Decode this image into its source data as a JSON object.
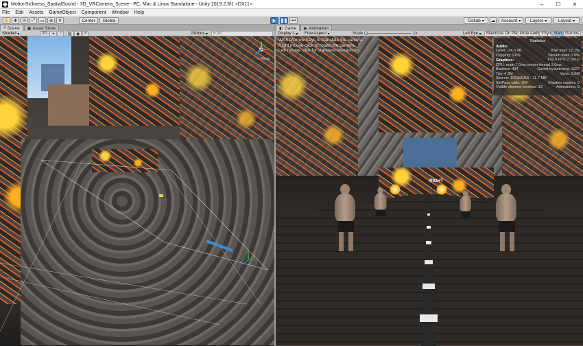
{
  "window": {
    "title": "MotionSickness_SpatialSound - 3D_VRCamera_Scene - PC, Mac & Linux Standalone - Unity 2019.2.3f1 <DX11>",
    "controls": {
      "minimize": "–",
      "maximize": "☐",
      "close": "✕"
    }
  },
  "menu": [
    "File",
    "Edit",
    "Assets",
    "GameObject",
    "Component",
    "Window",
    "Help"
  ],
  "toolbar": {
    "pivot_label": "Center",
    "space_label": "Global",
    "collab_label": "Collab",
    "account_label": "Account",
    "layers_label": "Layers",
    "layout_label": "Layout"
  },
  "scene_panel": {
    "tabs": [
      "Scene",
      "Asset Store"
    ],
    "shading_mode": "Shaded",
    "mode_2d": "2D",
    "gizmos_label": "Gizmos",
    "search_placeholder": "All",
    "persp_label": "< Persp"
  },
  "game_panel": {
    "tabs": [
      "Game",
      "Animation"
    ],
    "display": "Display 1",
    "aspect": "Free Aspect",
    "scale_label": "Scale",
    "scale_value": "1x",
    "eye": "Left Eye",
    "maximize_on_play": "Maximize On Play",
    "mute_audio": "Mute Audio",
    "vsync": "VSync",
    "stats": "Stats",
    "gizmos": "Gizmos",
    "instructions": [
      "WASD/Arrow Keys to translate the camera",
      "Right mouse click to rotate the camera",
      "Left mouse click for standard interactions."
    ],
    "sign_text": "RIGHT"
  },
  "statistics": {
    "title": "Statistics",
    "audio_header": "Audio:",
    "level": "Level: -34.5 dB",
    "dsp_load": "DSP load: 12.1%",
    "clipping": "Clipping: 0.0%",
    "stream_load": "Stream load: 0.0%",
    "graphics_header": "Graphics:",
    "fps": "142.9 FPS (7.0ms)",
    "cpu": "CPU: main 7.0ms  render thread 3.0ms",
    "batches": "Batches: 494",
    "saved_batching": "Saved by batching: 1927",
    "tris": "Tris: 4.3M",
    "verts": "Verts: 3.6M",
    "screen": "Screen: 1003x1015 - 11.7 MB",
    "setpass": "SetPass calls: 154",
    "shadow_casters": "Shadow casters: 0",
    "skinned": "Visible skinned meshes: 13",
    "animations": "Animations: 0"
  },
  "colors": {
    "play_active": "#3f7fbd",
    "editor_bg": "#c2c2c2",
    "lava_orange": "#ff9a2a"
  }
}
